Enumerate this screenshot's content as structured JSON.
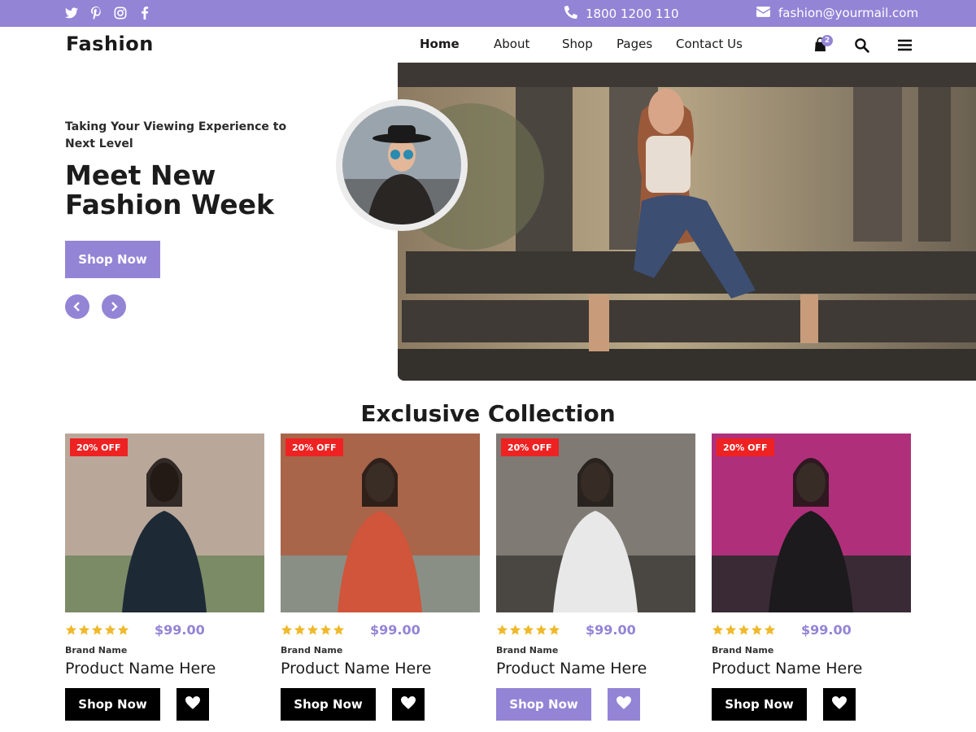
{
  "topbar": {
    "social_icons": [
      "twitter-icon",
      "pinterest-icon",
      "instagram-icon",
      "facebook-icon"
    ],
    "phone": "1800 1200 110",
    "email": "fashion@yourmail.com"
  },
  "nav": {
    "logo": "Fashion",
    "items": [
      "Home",
      "About",
      "Shop",
      "Pages",
      "Contact Us"
    ],
    "active": "Home",
    "cart_count": "2"
  },
  "hero": {
    "subtitle": "Taking Your Viewing Experience to Next Level",
    "title": "Meet New Fashion Week",
    "button": "Shop Now"
  },
  "collection": {
    "title": "Exclusive Collection",
    "products": [
      {
        "badge": "20% OFF",
        "rating": 5,
        "price": "$99.00",
        "brand": "Brand Name",
        "name": "Product Name Here",
        "button": "Shop Now",
        "active": false
      },
      {
        "badge": "20% OFF",
        "rating": 5,
        "price": "$99.00",
        "brand": "Brand Name",
        "name": "Product Name Here",
        "button": "Shop Now",
        "active": false
      },
      {
        "badge": "20% OFF",
        "rating": 5,
        "price": "$99.00",
        "brand": "Brand Name",
        "name": "Product Name Here",
        "button": "Shop Now",
        "active": true
      },
      {
        "badge": "20% OFF",
        "rating": 5,
        "price": "$99.00",
        "brand": "Brand Name",
        "name": "Product Name Here",
        "button": "Shop Now",
        "active": false
      }
    ]
  },
  "colors": {
    "accent": "#9484d6",
    "badge": "#ee2222",
    "star": "#f0b92b",
    "button_dark": "#000000"
  }
}
